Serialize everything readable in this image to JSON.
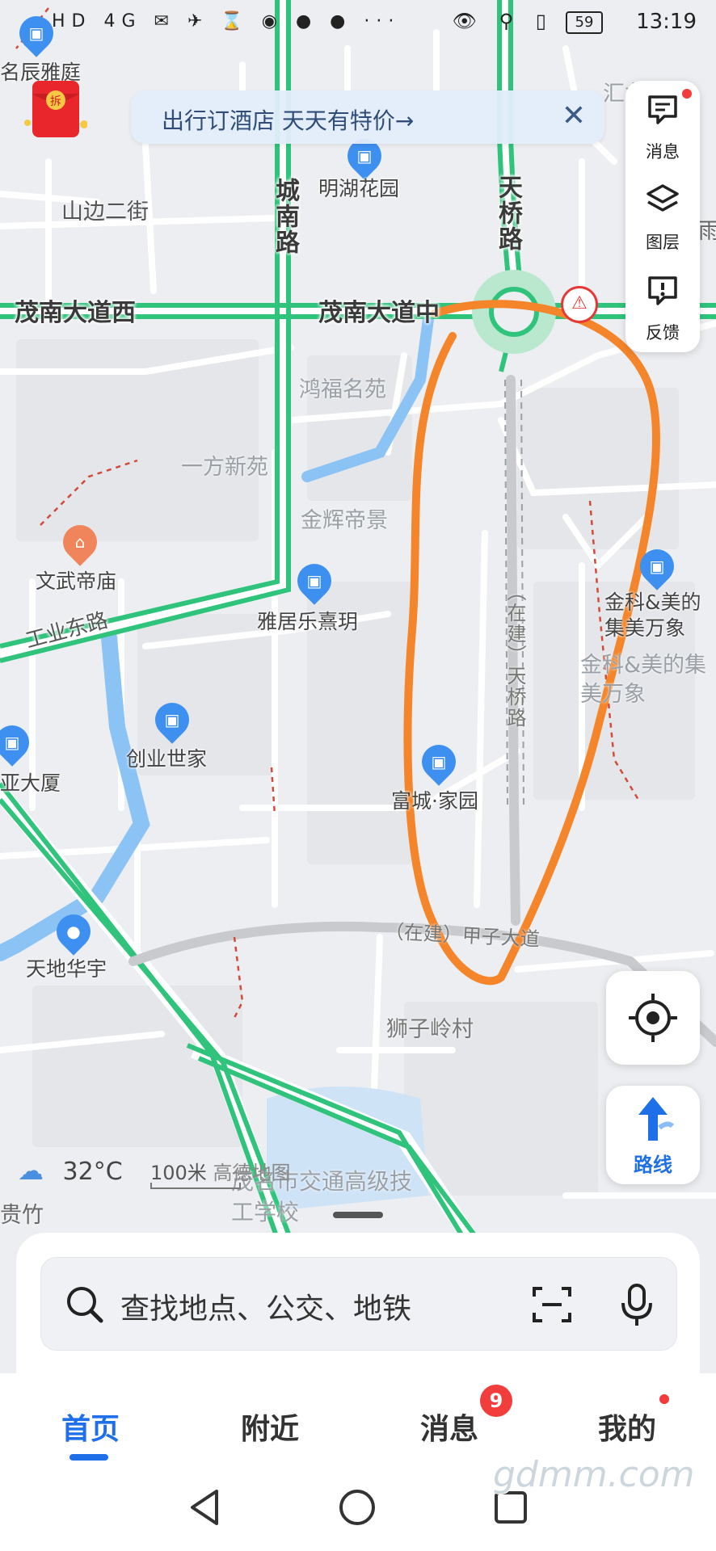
{
  "status_bar": {
    "time": "13:19",
    "battery": "59",
    "network": "HD 4G",
    "left_icons": "✉ ✈ ⌛ ◉ ● ● ···",
    "right_icons": "👁 ⚲ ▯"
  },
  "promo": {
    "text": "出行订酒店 天天有特价→",
    "close_icon": "close-icon"
  },
  "side_tools": [
    {
      "label": "消息",
      "icon": "message-icon"
    },
    {
      "label": "图层",
      "icon": "layers-icon"
    },
    {
      "label": "反馈",
      "icon": "feedback-icon"
    }
  ],
  "roads": {
    "maonan_west": "茂南大道西",
    "maonan_mid": "茂南大道中",
    "chengnan": "城南路",
    "tianqiao": "天桥路",
    "shanbian": "山边二街",
    "gongye_east": "工业东路",
    "tianqiao_building": "（在建）天桥路",
    "jiazi_building": "（在建）甲子大道"
  },
  "areas": {
    "hongfu": "鸿福名苑",
    "yifang": "一方新苑",
    "jinhui": "金辉帝景",
    "jinke_gray": "金科&美的集美万象",
    "shizi": "狮子岭村",
    "school": "茂名市交通高级技工学校",
    "huilong": "汇龙雅苑",
    "mingchen": "名辰雅庭",
    "yazhu": "贵竹",
    "edge_right": "雨苑"
  },
  "pois": {
    "minghu": "明湖花园",
    "wenwu": "文武帝庙",
    "yajule": "雅居乐熹玥",
    "chuangye": "创业世家",
    "fucheng": "富城·家园",
    "jinke": "金科&美的集美万象",
    "tiandi": "天地华宇",
    "yaxia": "亚大厦"
  },
  "weather": {
    "temp": "32°C",
    "icon": "cloud-icon"
  },
  "scale": {
    "label": "100米",
    "brand": "高德地图"
  },
  "route_button": {
    "label": "路线"
  },
  "search": {
    "placeholder": "查找地点、公交、地铁"
  },
  "nav": {
    "items": [
      "首页",
      "附近",
      "消息",
      "我的"
    ],
    "messages_badge": "9",
    "active_index": 0
  },
  "watermark": "gdmm.com",
  "colors": {
    "road_green": "#2fc37c",
    "annotation_orange": "#f4852a",
    "accent_blue": "#1f6fe8",
    "water_blue": "#8cc3f5",
    "map_bg": "#eceef1"
  }
}
